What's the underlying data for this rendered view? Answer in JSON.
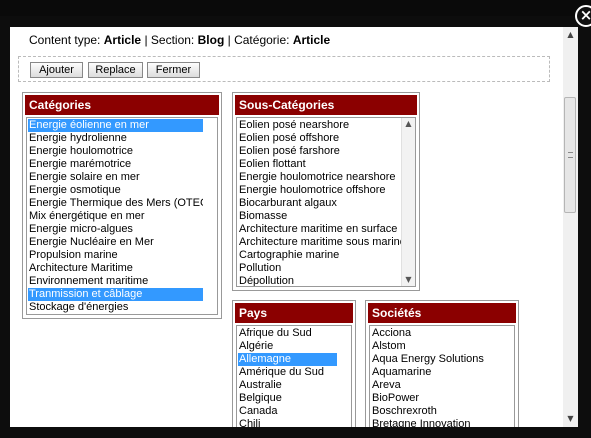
{
  "close_button": {
    "symbol": "×"
  },
  "header": {
    "content_type_label": "Content type:",
    "content_type_value": "Article",
    "sep1": "|",
    "section_label": "Section:",
    "section_value": "Blog",
    "sep2": "|",
    "categorie_label": "Catégorie:",
    "categorie_value": "Article"
  },
  "toolbar": {
    "add_label": "Ajouter",
    "replace_label": "Replace",
    "close_label": "Fermer"
  },
  "colors": {
    "panel_header": "#8b0000",
    "selection": "#3399ff"
  },
  "panels": {
    "categories": {
      "title": "Catégories",
      "items": [
        "Energie éolienne en mer",
        "Energie hydrolienne",
        "Energie houlomotrice",
        "Energie marémotrice",
        "Energie solaire en mer",
        "Energie osmotique",
        "Energie Thermique des Mers (OTEC)",
        "Mix énergétique en mer",
        "Energie micro-algues",
        "Energie Nucléaire en Mer",
        "Propulsion marine",
        "Architecture Maritime",
        "Environnement maritime",
        "Tranmission et câblage",
        "Stockage d'énergies"
      ],
      "selected": [
        0,
        13
      ]
    },
    "sous_categories": {
      "title": "Sous-Catégories",
      "items": [
        "Eolien posé nearshore",
        "Eolien posé offshore",
        "Eolien posé farshore",
        "Eolien flottant",
        "Energie houlomotrice nearshore",
        "Energie houlomotrice offshore",
        "Biocarburant algaux",
        "Biomasse",
        "Architecture maritime en surface",
        "Architecture maritime sous marine",
        "Cartographie marine",
        "Pollution",
        "Dépollution"
      ],
      "selected": []
    },
    "pays": {
      "title": "Pays",
      "items": [
        "Afrique du Sud",
        "Algérie",
        "Allemagne",
        "Amérique du Sud",
        "Australie",
        "Belgique",
        "Canada",
        "Chili"
      ],
      "selected": [
        2
      ]
    },
    "societes": {
      "title": "Sociétés",
      "items": [
        "Acciona",
        "Alstom",
        "Aqua Energy Solutions",
        "Aquamarine",
        "Areva",
        "BioPower",
        "Boschrexroth",
        "Bretagne Innovation"
      ],
      "selected": []
    }
  }
}
